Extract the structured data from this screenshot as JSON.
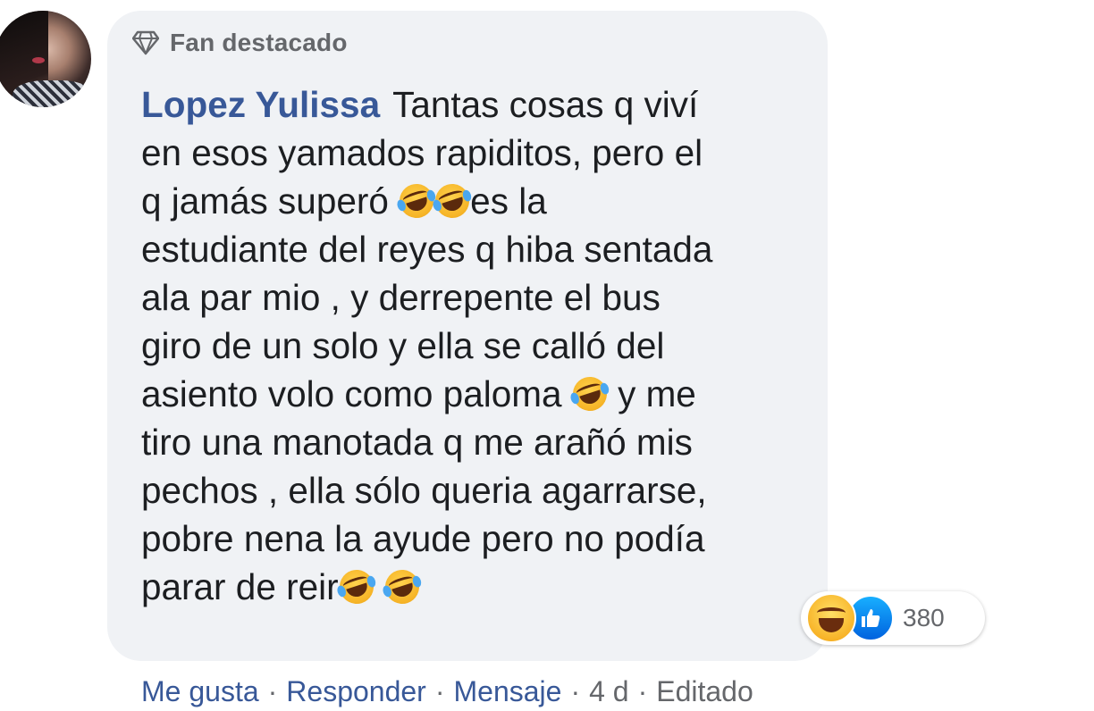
{
  "comment": {
    "badge_label": "Fan destacado",
    "author": "Lopez Yulissa",
    "lines": [
      "Tantas cosas q viví",
      "en esos yamados rapiditos, pero el",
      "q jamás superó",
      "es la",
      "estudiante del reyes q hiba sentada",
      "ala par mio , y derrepente el bus",
      "giro de un solo y ella se calló del",
      "asiento volo como paloma",
      "y me",
      "tiro una manotada q me arañó mis",
      "pechos , ella sólo queria agarrarse,",
      "pobre nena la ayude pero no podía",
      "parar de reir"
    ],
    "emoji_icon": "rolling-on-floor-laughing-emoji"
  },
  "reactions": {
    "icons": [
      "haha-reaction-icon",
      "like-reaction-icon"
    ],
    "count": "380"
  },
  "actions": {
    "like": "Me gusta",
    "reply": "Responder",
    "message": "Mensaje",
    "time": "4 d",
    "edited": "Editado",
    "separator": "·"
  },
  "colors": {
    "bubble_bg": "#f0f2f5",
    "author": "#385898",
    "action_link": "#385898",
    "meta_text": "#65676b"
  }
}
